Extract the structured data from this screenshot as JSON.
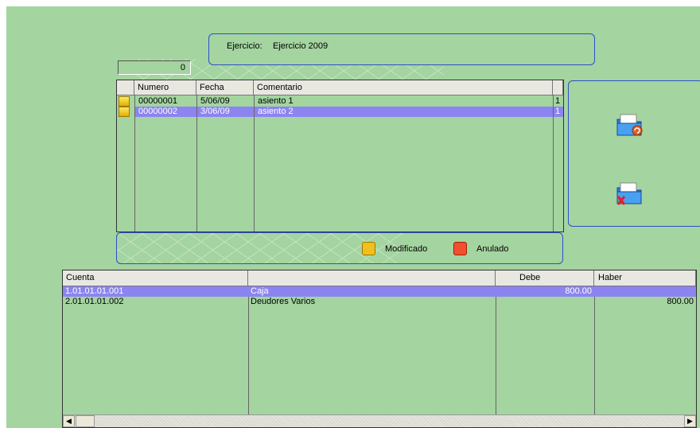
{
  "header": {
    "label": "Ejercicio:",
    "value": "Ejercicio 2009"
  },
  "counter": {
    "value": "0"
  },
  "asientos": {
    "columns": [
      "Numero",
      "Fecha",
      "Comentario",
      ""
    ],
    "rows": [
      {
        "numero": "00000001",
        "fecha": "5/06/09",
        "comentario": "asiento 1",
        "flag": "1",
        "selected": false
      },
      {
        "numero": "00000002",
        "fecha": "3/06/09",
        "comentario": "asiento 2",
        "flag": "1",
        "selected": true
      }
    ]
  },
  "actions": {
    "restore_icon": "folder-restore-icon",
    "delete_icon": "folder-delete-icon"
  },
  "legend": {
    "modified": {
      "label": "Modificado",
      "color": "#f0c020"
    },
    "cancelled": {
      "label": "Anulado",
      "color": "#f05030"
    }
  },
  "detalle": {
    "columns": [
      "Cuenta",
      "",
      "Debe",
      "Haber"
    ],
    "rows": [
      {
        "cuenta": "1.01.01.01.001",
        "nombre": "Caja",
        "debe": "800.00",
        "haber": "",
        "selected": true
      },
      {
        "cuenta": "2.01.01.01.002",
        "nombre": "Deudores Varios",
        "debe": "",
        "haber": "800.00",
        "selected": false
      }
    ]
  },
  "colors": {
    "background": "#a4d4a0",
    "selection": "#8c84f0",
    "panel_border": "#2c4fc8"
  }
}
